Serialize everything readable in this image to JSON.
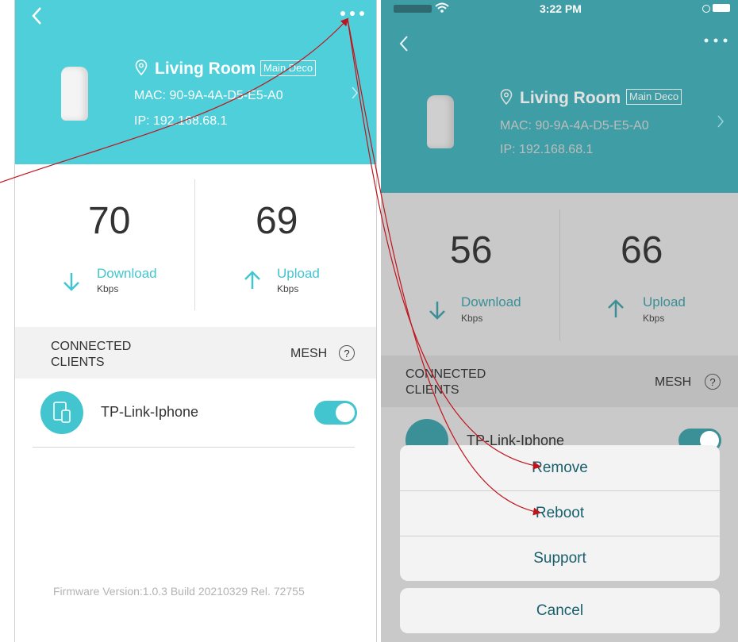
{
  "left": {
    "header": {
      "back_icon": "chevron-left-icon",
      "more_icon": "more-dots-icon",
      "location_name": "Living Room",
      "main_tag": "Main Deco",
      "mac": "MAC: 90-9A-4A-D5-E5-A0",
      "ip": "IP: 192.168.68.1"
    },
    "speed": {
      "download_value": "70",
      "download_label": "Download",
      "download_unit": "Kbps",
      "upload_value": "69",
      "upload_label": "Upload",
      "upload_unit": "Kbps"
    },
    "clients": {
      "section_title_line1": "CONNECTED",
      "section_title_line2": "CLIENTS",
      "mesh_label": "MESH",
      "help_glyph": "?",
      "items": [
        {
          "name": "TP-Link-Iphone",
          "toggle_on": true
        }
      ]
    },
    "firmware": "Firmware Version:1.0.3 Build 20210329 Rel. 72755"
  },
  "right": {
    "status_bar": {
      "time": "3:22 PM"
    },
    "header": {
      "location_name": "Living Room",
      "main_tag": "Main Deco",
      "mac": "MAC: 90-9A-4A-D5-E5-A0",
      "ip": "IP: 192.168.68.1"
    },
    "speed": {
      "download_value": "56",
      "download_label": "Download",
      "download_unit": "Kbps",
      "upload_value": "66",
      "upload_label": "Upload",
      "upload_unit": "Kbps"
    },
    "clients": {
      "section_title_line1": "CONNECTED",
      "section_title_line2": "CLIENTS",
      "mesh_label": "MESH",
      "help_glyph": "?",
      "items": [
        {
          "name": "TP-Link-Iphone",
          "toggle_on": true
        }
      ]
    },
    "action_sheet": {
      "remove": "Remove",
      "reboot": "Reboot",
      "support": "Support",
      "cancel": "Cancel"
    }
  },
  "colors": {
    "accent": "#4fcfd9",
    "annotation_arrow": "#c0141c"
  }
}
